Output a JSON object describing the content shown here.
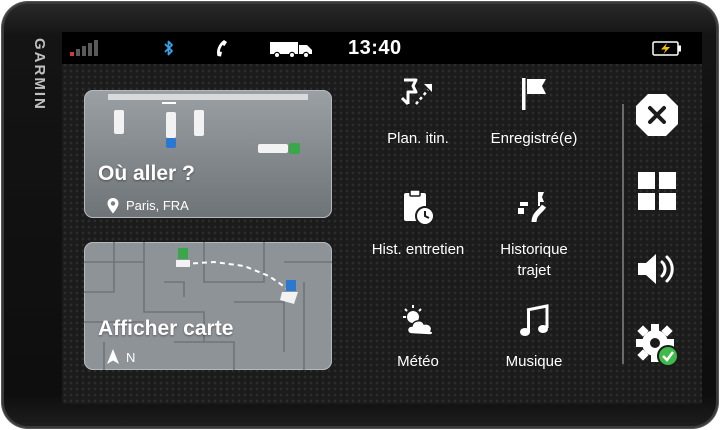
{
  "device": {
    "brand": "GARMIN"
  },
  "status": {
    "time": "13:40",
    "signal_bars_on": 1,
    "signal_bars_total": 5,
    "colors": {
      "signal_active": "#d23a3a",
      "bluetooth": "#3aa0e8",
      "battery_bolt": "#f2c200"
    }
  },
  "cards": {
    "where_to": {
      "title": "Où aller ?",
      "location": "Paris, FRA"
    },
    "show_map": {
      "title": "Afficher carte",
      "heading": "N"
    }
  },
  "grid": {
    "plan_route": "Plan. itin.",
    "saved": "Enregistré(e)",
    "maintenance_history": "Hist. entretien",
    "trip_history_line1": "Historique",
    "trip_history_line2": "trajet",
    "weather": "Météo",
    "music": "Musique"
  },
  "sidebar": {
    "icons": [
      "close-icon",
      "apps-grid-icon",
      "volume-icon",
      "settings-icon"
    ],
    "colors": {
      "settings_check": "#3fb94a"
    }
  }
}
